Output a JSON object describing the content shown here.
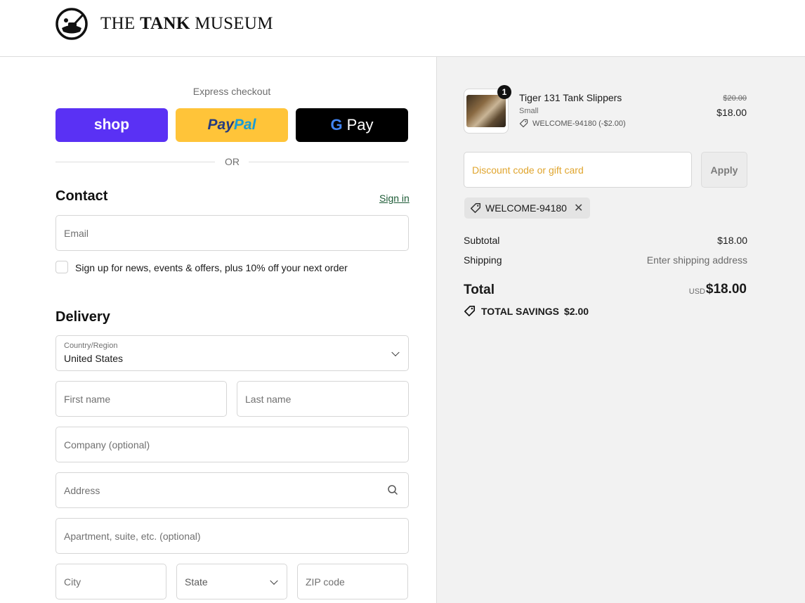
{
  "header": {
    "brand_prefix": "THE",
    "brand_bold": "TANK",
    "brand_suffix": "MUSEUM"
  },
  "express": {
    "label": "Express checkout",
    "shop_label": "shop",
    "paypal_part1": "Pay",
    "paypal_part2": "Pal",
    "gpay_g": "G",
    "gpay_label": "Pay",
    "or_text": "OR"
  },
  "contact": {
    "title": "Contact",
    "signin_label": "Sign in",
    "email_placeholder": "Email",
    "newsletter_label": "Sign up for news, events & offers, plus 10% off your next order",
    "newsletter_checked": false
  },
  "delivery": {
    "title": "Delivery",
    "country_label": "Country/Region",
    "country_value": "United States",
    "first_name_placeholder": "First name",
    "last_name_placeholder": "Last name",
    "company_placeholder": "Company (optional)",
    "address_placeholder": "Address",
    "apartment_placeholder": "Apartment, suite, etc. (optional)",
    "city_placeholder": "City",
    "state_label": "State",
    "zip_placeholder": "ZIP code"
  },
  "summary": {
    "item": {
      "quantity": "1",
      "name": "Tiger 131 Tank Slippers",
      "variant": "Small",
      "discount_line": "WELCOME-94180 (-$2.00)",
      "original_price": "$20.00",
      "price": "$18.00"
    },
    "discount_placeholder": "Discount code or gift card",
    "apply_label": "Apply",
    "applied_code": "WELCOME-94180",
    "subtotal_label": "Subtotal",
    "subtotal_value": "$18.00",
    "shipping_label": "Shipping",
    "shipping_value": "Enter shipping address",
    "total_label": "Total",
    "total_currency": "USD",
    "total_value": "$18.00",
    "savings_label": "TOTAL SAVINGS",
    "savings_value": "$2.00"
  },
  "colors": {
    "shop_purple": "#5a31f4",
    "paypal_yellow": "#ffc439",
    "gpay_black": "#000000",
    "link_green": "#1c5a35"
  }
}
